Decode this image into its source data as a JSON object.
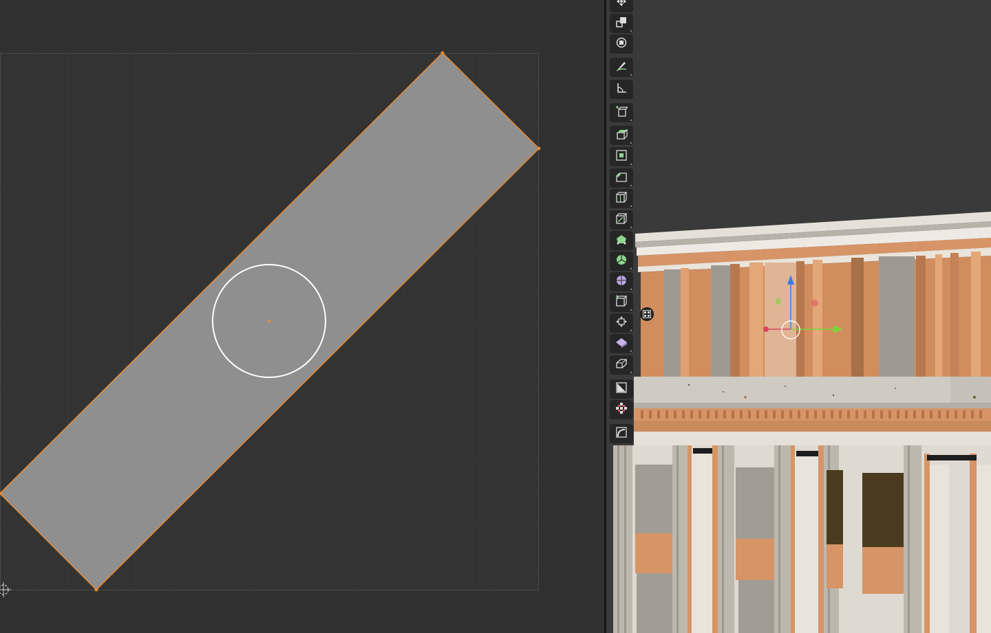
{
  "uv_editor": {
    "label": "uv-editor",
    "colors": {
      "background": "#303030",
      "uv_face": "#8f8f8f",
      "uv_edge": "#e08a36",
      "cursor_circle": "#ffffff"
    }
  },
  "viewport": {
    "colors": {
      "background": "#3a3a3a",
      "wall": "#d79466",
      "stone": "#cfcac2",
      "gizmo_x": "#7ad33a",
      "gizmo_y": "#e0455a",
      "gizmo_z": "#3d7cf0"
    }
  },
  "toolbar": {
    "tools": [
      {
        "icon": "transform-icon"
      },
      {
        "icon": "scale-icon"
      },
      {
        "icon": "pivot-transform-icon"
      },
      {
        "icon": "annotate-icon"
      },
      {
        "icon": "measure-icon"
      },
      {
        "icon": "add-cube-icon"
      },
      {
        "icon": "extrude-region-icon"
      },
      {
        "icon": "inset-faces-icon"
      },
      {
        "icon": "bevel-icon"
      },
      {
        "icon": "loop-cut-icon"
      },
      {
        "icon": "knife-icon"
      },
      {
        "icon": "poly-build-icon"
      },
      {
        "icon": "spin-icon"
      },
      {
        "icon": "smooth-icon"
      },
      {
        "icon": "edge-slide-icon"
      },
      {
        "icon": "shrink-fatten-icon"
      },
      {
        "icon": "shear-icon"
      },
      {
        "icon": "rip-region-icon"
      },
      {
        "icon": "uv-select-icon"
      },
      {
        "icon": "uv-grab-icon"
      },
      {
        "icon": "uv-rotate-icon"
      }
    ]
  }
}
